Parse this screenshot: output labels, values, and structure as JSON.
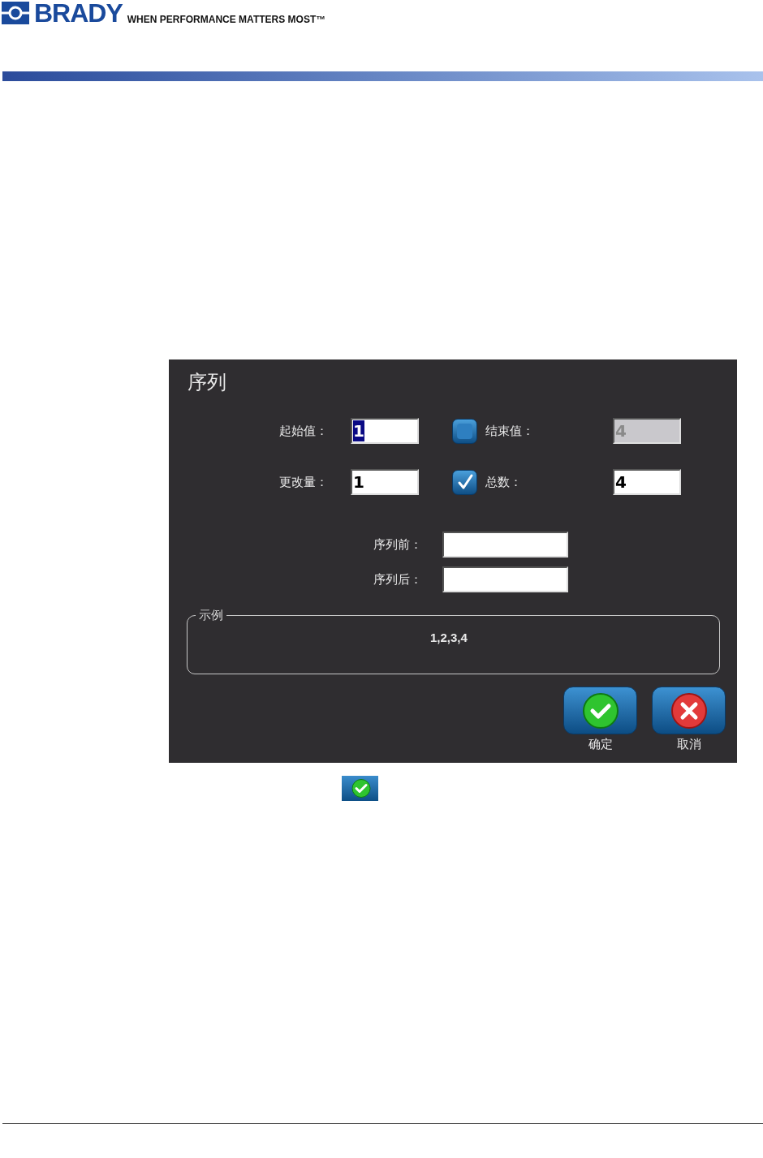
{
  "header": {
    "brand": "BRADY",
    "tagline": "WHEN PERFORMANCE MATTERS MOST™"
  },
  "dialog": {
    "title": "序列",
    "value_fields": [
      {
        "label": "起始值：",
        "value": "1",
        "highlighted": true
      },
      {
        "label": "更改量：",
        "value": "1",
        "highlighted": false
      }
    ],
    "limit_options": [
      {
        "label": "结束值：",
        "checked": false,
        "value": "4",
        "disabled": true
      },
      {
        "label": "总数：",
        "checked": true,
        "value": "4",
        "disabled": false
      }
    ],
    "affix_fields": [
      {
        "label": "序列前："
      },
      {
        "label": "序列后："
      }
    ],
    "example": {
      "legend": "示例",
      "text": "1,2,3,4"
    },
    "buttons": [
      {
        "kind": "ok",
        "label": "确定"
      },
      {
        "kind": "cancel",
        "label": "取消"
      }
    ]
  }
}
